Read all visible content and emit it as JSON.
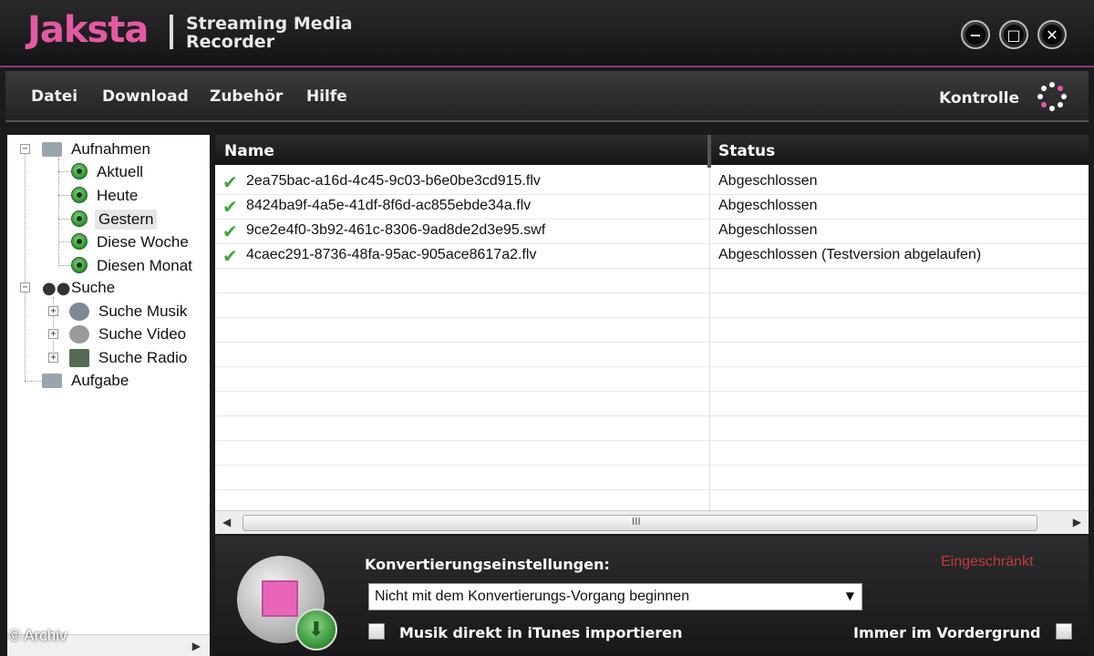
{
  "app": {
    "logo": "Jaksta",
    "subtitle_line1": "Streaming Media",
    "subtitle_line2": "Recorder",
    "window_buttons": {
      "minimize": "−",
      "maximize": "□",
      "close": "✕"
    }
  },
  "menu": {
    "items": [
      "Datei",
      "Download",
      "Zubehör",
      "Hilfe"
    ],
    "kontrolle": "Kontrolle"
  },
  "sidebar": {
    "aufnahmen": "Aufnahmen",
    "aufnahmen_children": [
      "Aktuell",
      "Heute",
      "Gestern",
      "Diese Woche",
      "Diesen Monat"
    ],
    "selected": "Gestern",
    "suche": "Suche",
    "suche_children": [
      "Suche Musik",
      "Suche Video",
      "Suche Radio"
    ],
    "aufgabe": "Aufgabe"
  },
  "list": {
    "columns": [
      "Name",
      "Status"
    ],
    "rows": [
      {
        "name": "2ea75bac-a16d-4c45-9c03-b6e0be3cd915.flv",
        "status": "Abgeschlossen"
      },
      {
        "name": "8424ba9f-4a5e-41df-8f6d-ac855ebde34a.flv",
        "status": "Abgeschlossen"
      },
      {
        "name": "9ce2e4f0-3b92-461c-8306-9ad8de2d3e95.swf",
        "status": "Abgeschlossen"
      },
      {
        "name": "4caec291-8736-48fa-95ac-905ace8617a2.flv",
        "status": "Abgeschlossen (Testversion abgelaufen)"
      }
    ],
    "scroll_grip": "III"
  },
  "bottom": {
    "conversion_label": "Konvertierungseinstellungen:",
    "restricted": "Eingeschränkt",
    "conversion_value": "Nicht mit dem Konvertierungs-Vorgang beginnen",
    "itunes_label": "Musik direkt in iTunes importieren",
    "foreground_label": "Immer im Vordergrund"
  },
  "watermark": "© Archiv",
  "colors": {
    "accent": "#e35aa2",
    "restricted": "#c23a3a",
    "success": "#3ca83c"
  }
}
